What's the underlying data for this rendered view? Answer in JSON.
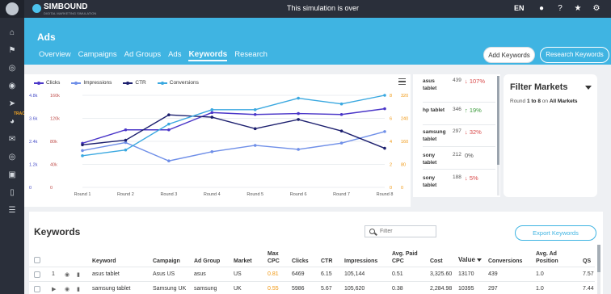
{
  "topbar": {
    "brand": "SIMBOUND",
    "brand_tagline": "DIGITAL MARKETING SIMULATION",
    "status": "This simulation is over",
    "language": "EN",
    "icons": [
      "user-icon",
      "help-icon",
      "bulb-icon",
      "gear-icon",
      "exit-icon"
    ]
  },
  "sidebar": {
    "items": [
      {
        "icon": "home-icon"
      },
      {
        "icon": "flag-icon"
      },
      {
        "icon": "target-icon"
      },
      {
        "icon": "globe-icon"
      },
      {
        "icon": "megaphone-icon",
        "badge": "TRACK"
      },
      {
        "icon": "analytics-icon"
      },
      {
        "icon": "email-icon"
      },
      {
        "icon": "settings-target-icon"
      },
      {
        "icon": "social-icon"
      },
      {
        "icon": "mobile-icon"
      },
      {
        "icon": "list-icon"
      }
    ]
  },
  "header": {
    "title": "Ads",
    "tabs": [
      {
        "label": "Overview",
        "active": false
      },
      {
        "label": "Campaigns",
        "active": false
      },
      {
        "label": "Ad Groups",
        "active": false
      },
      {
        "label": "Ads",
        "active": false
      },
      {
        "label": "Keywords",
        "active": true
      },
      {
        "label": "Research",
        "active": false
      }
    ],
    "add_keywords": "Add Keywords",
    "research_keywords": "Research Keywords"
  },
  "chart_data": {
    "type": "line",
    "categories": [
      "Round 1",
      "Round 2",
      "Round 3",
      "Round 4",
      "Round 5",
      "Round 6",
      "Round 7",
      "Round 8"
    ],
    "left_axis_1": {
      "ticks": [
        "0",
        "1.2k",
        "2.4k",
        "3.6k",
        "4.8k"
      ],
      "color": "#4a50c8"
    },
    "left_axis_2": {
      "ticks": [
        "0",
        "40k",
        "80k",
        "120k",
        "160k"
      ],
      "color": "#c0504d"
    },
    "right_axis_1": {
      "ticks": [
        "0",
        "2",
        "4",
        "6",
        "8"
      ],
      "color": "#f0960e"
    },
    "right_axis_2": {
      "ticks": [
        "0",
        "80",
        "160",
        "240",
        "320"
      ],
      "color": "#f0960e"
    },
    "series": [
      {
        "name": "Clicks",
        "color": "#4a36c8",
        "axis": "left_axis_1",
        "values": [
          2300,
          3000,
          3000,
          3900,
          3800,
          3850,
          3800,
          4100
        ]
      },
      {
        "name": "Impressions",
        "color": "#6f8fe8",
        "axis": "left_axis_2",
        "values": [
          64000,
          78000,
          46000,
          62000,
          73000,
          66000,
          77000,
          97000
        ]
      },
      {
        "name": "CTR",
        "color": "#1c1f6e",
        "axis": "right_axis_1",
        "values": [
          3.7,
          4.1,
          6.3,
          6.1,
          5.1,
          5.9,
          4.9,
          3.4
        ]
      },
      {
        "name": "Conversions",
        "color": "#3aa8e0",
        "axis": "right_axis_2",
        "values": [
          110,
          130,
          220,
          270,
          270,
          310,
          290,
          320
        ]
      }
    ],
    "grid": true,
    "legend": "top-left"
  },
  "top_keywords": [
    {
      "name": "asus tablet",
      "value": "439",
      "change": "107%",
      "direction": "down"
    },
    {
      "name": "hp tablet",
      "value": "346",
      "change": "19%",
      "direction": "up"
    },
    {
      "name": "samsung tablet",
      "value": "297",
      "change": "32%",
      "direction": "down"
    },
    {
      "name": "sony tablet",
      "value": "212",
      "change": "0%",
      "direction": "flat"
    },
    {
      "name": "sony tablet",
      "value": "188",
      "change": "5%",
      "direction": "down"
    }
  ],
  "filter": {
    "title": "Filter Markets",
    "round_prefix": "Round",
    "round_range": "1 to 8",
    "on_text": "on",
    "markets": "All Markets"
  },
  "keywords_table": {
    "title": "Keywords",
    "search_placeholder": "Filter",
    "export": "Export Keywords",
    "headers": [
      "Keyword",
      "Campaign",
      "Ad Group",
      "Market",
      "Max CPC",
      "Clicks",
      "CTR",
      "Impressions",
      "Avg. Paid CPC",
      "Cost",
      "Value",
      "Conversions",
      "Avg. Ad Position",
      "QS"
    ],
    "rows": [
      {
        "num": "1",
        "keyword": "asus tablet",
        "campaign": "Asus US",
        "ad_group": "asus",
        "market": "US",
        "max_cpc": "0.81",
        "clicks": "6469",
        "ctr": "6.15",
        "impressions": "105,144",
        "avg_cpc": "0.51",
        "cost": "3,325.60",
        "value": "13170",
        "conversions": "439",
        "position": "1.0",
        "qs": "7.57"
      },
      {
        "num": "",
        "keyword": "samsung tablet",
        "campaign": "Samsung UK",
        "ad_group": "samsung",
        "market": "UK",
        "max_cpc": "0.55",
        "clicks": "5986",
        "ctr": "5.67",
        "impressions": "105,620",
        "avg_cpc": "0.38",
        "cost": "2,284.98",
        "value": "10395",
        "conversions": "297",
        "position": "1.0",
        "qs": "7.44"
      }
    ]
  }
}
